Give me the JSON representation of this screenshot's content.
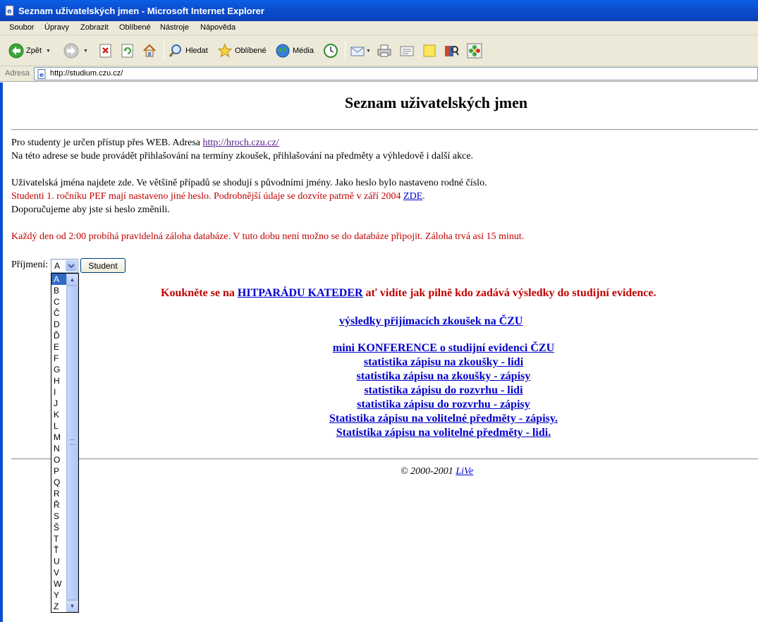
{
  "window": {
    "title": "Seznam uživatelských jmen - Microsoft Internet Explorer"
  },
  "menu": [
    "Soubor",
    "Úpravy",
    "Zobrazit",
    "Oblíbené",
    "Nástroje",
    "Nápověda"
  ],
  "toolbar": {
    "back_label": "Zpět",
    "search_label": "Hledat",
    "favorites_label": "Oblíbené",
    "media_label": "Média"
  },
  "address": {
    "label": "Adresa",
    "url": "http://studium.czu.cz/"
  },
  "page": {
    "title": "Seznam uživatelských jmen",
    "intro_text": "Pro studenty je určen přístup přes WEB. Adresa ",
    "intro_link": "http://hroch.czu.cz/",
    "intro_line2": "Na této adrese se bude provádět přihlašování na termíny zkoušek, přihlašování na předměty a výhledově i další akce.",
    "usernames_line": "Uživatelská jména najdete zde. Ve většině případů se shodují s původními jmény. Jako heslo bylo nastaveno rodné číslo.",
    "pef_notice": "Studenti 1. ročníku PEF mají nastaveno jiné heslo. Podrobnější údaje se dozvíte patrně v září 2004 ",
    "pef_link": "ZDE",
    "pef_period": ".",
    "recommend_line": "Doporučujeme aby jste si heslo změnili.",
    "backup_notice": "Každý den od 2:00 probíhá pravidelná záloha databáze. V tuto dobu není možno se do databáze připojit. Záloha trvá asi 15 minut.",
    "surname_label": "Příjmení:",
    "selected_letter": "A",
    "student_button": "Student",
    "letters": [
      "A",
      "B",
      "C",
      "Č",
      "D",
      "Ď",
      "E",
      "F",
      "G",
      "H",
      "I",
      "J",
      "K",
      "L",
      "M",
      "N",
      "O",
      "P",
      "Q",
      "R",
      "Ř",
      "S",
      "Š",
      "T",
      "Ť",
      "U",
      "V",
      "W",
      "Y",
      "Z"
    ],
    "hitparade_before": "Koukněte se na ",
    "hitparade_link": "HITPARÁDU KATEDER",
    "hitparade_after": " ať vidíte jak pilně kdo zadává výsledky do studijní evidence.",
    "admission_link": "výsledky přijímacích zkoušek na ČZU",
    "links": [
      "mini KONFERENCE o studijní evidenci ČZU",
      "statistika zápisu na zkoušky - lidi",
      "statistika zápisu na zkoušky - zápisy",
      "statistika zápisu do rozvrhu - lidi",
      "statistika zápisu do rozvrhu - zápisy",
      "Statistika zápisu na volitelné předměty - zápisy.",
      "Statistika zápisu na volitelné předměty - lidi."
    ],
    "footer_text": "© 2000-2001 ",
    "footer_link": "LiVe"
  }
}
